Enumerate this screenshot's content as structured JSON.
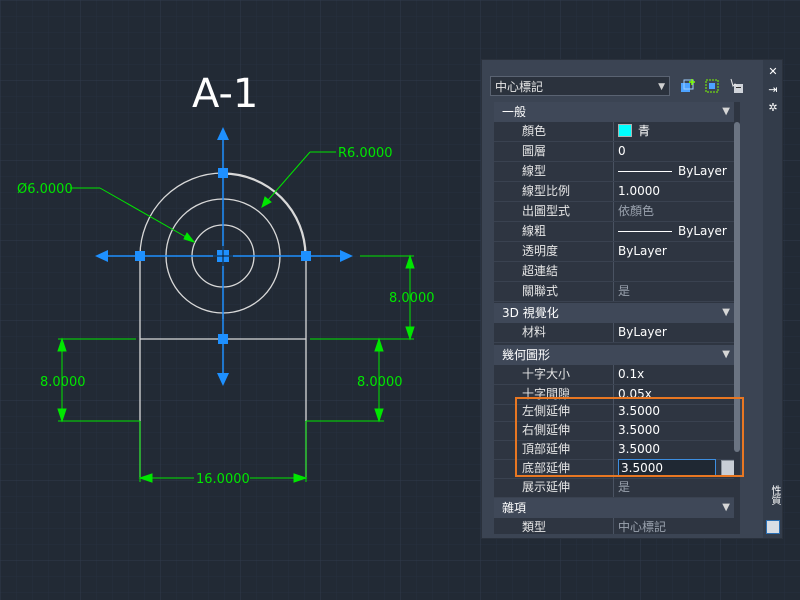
{
  "drawing": {
    "title": "A-1",
    "dimensions": {
      "radius": "R6.0000",
      "diameter": "Ø6.0000",
      "height_right": "8.0000",
      "height_left": "8.0000",
      "height_lower_right": "8.0000",
      "width_bottom": "16.0000"
    }
  },
  "palette": {
    "object_type": "中心標記",
    "categories": {
      "general": "一般",
      "viz3d": "3D 視覺化",
      "geometry": "幾何圖形",
      "misc": "雜項"
    },
    "general_rows": [
      {
        "name": "顏色",
        "value": "青"
      },
      {
        "name": "圖層",
        "value": "0"
      },
      {
        "name": "線型",
        "value": "ByLayer"
      },
      {
        "name": "線型比例",
        "value": "1.0000"
      },
      {
        "name": "出圖型式",
        "value": "依顏色"
      },
      {
        "name": "線粗",
        "value": "ByLayer"
      },
      {
        "name": "透明度",
        "value": "ByLayer"
      },
      {
        "name": "超連結",
        "value": ""
      },
      {
        "name": "關聯式",
        "value": "是"
      }
    ],
    "viz3d_rows": [
      {
        "name": "材料",
        "value": "ByLayer"
      }
    ],
    "geometry_rows": [
      {
        "name": "十字大小",
        "value": "0.1x"
      },
      {
        "name": "十字間隙",
        "value": "0.05x"
      },
      {
        "name": "左側延伸",
        "value": "3.5000"
      },
      {
        "name": "右側延伸",
        "value": "3.5000"
      },
      {
        "name": "頂部延伸",
        "value": "3.5000"
      },
      {
        "name": "底部延伸",
        "value": "3.5000"
      },
      {
        "name": "展示延伸",
        "value": "是"
      }
    ],
    "misc_rows": [
      {
        "name": "類型",
        "value": "中心標記"
      }
    ],
    "side_title": "性質"
  },
  "colors": {
    "background": "#222a35",
    "dimension": "#00e600",
    "centermark": "#1e90ff",
    "highlight": "#e87722",
    "color_swatch": "#00ffff"
  }
}
